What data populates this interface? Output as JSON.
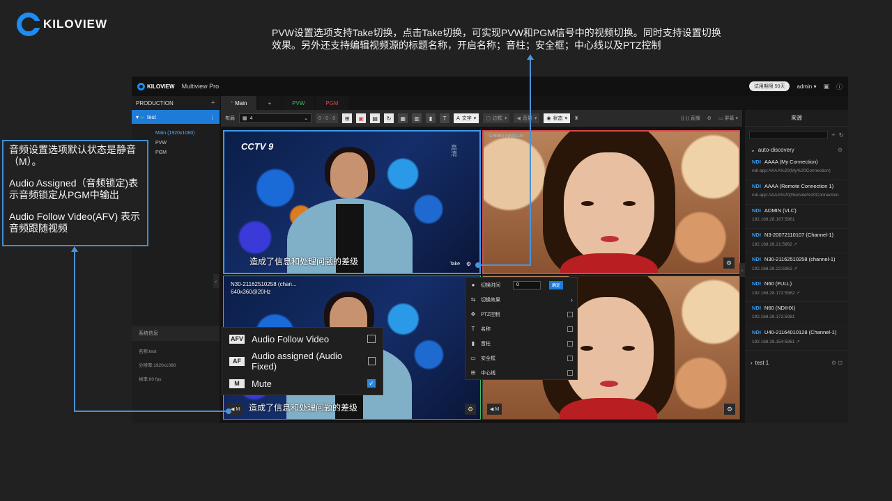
{
  "brand": {
    "logo_text": "KILOVIEW",
    "accent": "#1e8cf0"
  },
  "annotations": {
    "top": "PVW设置选项支持Take切换，点击Take切换，可实现PVW和PGM信号中的视频切换。同时支持设置切换效果。另外还支持编辑视频源的标题名称，开启名称；音柱；安全框；中心线以及PTZ控制",
    "left_line1": "音频设置选项默认状态是静音（M）。",
    "left_line2": "Audio Assigned（音频锁定)表示音频锁定从PGM中输出",
    "left_line3": "Audio Follow Video(AFV) 表示音频跟随视频"
  },
  "app": {
    "logo_text": "KILOVIEW",
    "title": "Multiview Pro",
    "trial_badge": "试用期限 50天",
    "user": "admin ▾",
    "icons": [
      "document-icon",
      "info-icon"
    ]
  },
  "sidebar": {
    "header": "PRODUCTION",
    "add": "+",
    "project": "test",
    "more": "⋮",
    "sub_items": [
      "Main (1920x1080)",
      "PVW",
      "PGM"
    ],
    "system_title": "系统信息",
    "system_rows": [
      "名称:test",
      "分辨率:1920x1080",
      "帧率:60 fps"
    ]
  },
  "tabs": {
    "main": "Main",
    "main_star": "*",
    "add": "+",
    "pvw": "PVW",
    "pgm": "PGM"
  },
  "toolbar": {
    "layout_label": "布局",
    "layout_value": "4",
    "layout_select2": "0 · 0 · 0",
    "text_label": "文字",
    "border_label": "边框",
    "audio_label": "音量",
    "status_label": "状态",
    "live_label": "直播",
    "screen_label": "屏幕"
  },
  "grid": {
    "pvw_logo": "CCTV 9",
    "subtitle": "造成了信息和处理问题的差级",
    "news_side": "高清",
    "watermark": "CHIMEI INNOLUX",
    "take_label": "Take",
    "source_name": "N30-21162510258 (chan...",
    "source_res": "640x360@20Hz",
    "audio_badge": "M",
    "gear": "⚙"
  },
  "pvw_menu": {
    "transition_time_label": "切换时间",
    "transition_time_value": "0",
    "confirm": "确定",
    "effect_label": "切换效果",
    "ptz_label": "PTZ控制",
    "name_label": "名称",
    "audio_meter_label": "音柱",
    "safe_area_label": "安全框",
    "center_line_label": "中心线"
  },
  "audio_menu": {
    "items": [
      {
        "tag": "AFV",
        "label": "Audio Follow Video",
        "checked": false
      },
      {
        "tag": "AF",
        "label": "Audio assigned (Audio Fixed)",
        "checked": false
      },
      {
        "tag": "M",
        "label": "Mute",
        "checked": true
      }
    ]
  },
  "sources": {
    "title": "来源",
    "group1": "auto-discovery",
    "group2": "test 1",
    "items": [
      {
        "type": "NDI",
        "name": "AAAA (My Connection)",
        "addr": "ndi-app:AAAA%20(My%20Connection)"
      },
      {
        "type": "NDI",
        "name": "AAAA (Remote Connection 1)",
        "addr": "ndi-app:AAAA%20(Remote%20Connection"
      },
      {
        "type": "NDI",
        "name": "ADMIN (VLC)",
        "addr": "192.168.28.167:5961"
      },
      {
        "type": "NDI",
        "name": "N3-20072110107 (Channel-1)",
        "addr": "192.168.28.21:5962 ↗"
      },
      {
        "type": "NDI",
        "name": "N30-21162510258 (channel-1)",
        "addr": "192.168.28.22:5962 ↗"
      },
      {
        "type": "NDI",
        "name": "N60 (FULL)",
        "addr": "192.168.28.172:5962 ↗"
      },
      {
        "type": "NDI",
        "name": "N60 (NDIHX)",
        "addr": "192.168.28.172:5981"
      },
      {
        "type": "NDI",
        "name": "U40-21164010128 (Channel-1)",
        "addr": "192.168.28.154:5961 ↗"
      }
    ]
  }
}
